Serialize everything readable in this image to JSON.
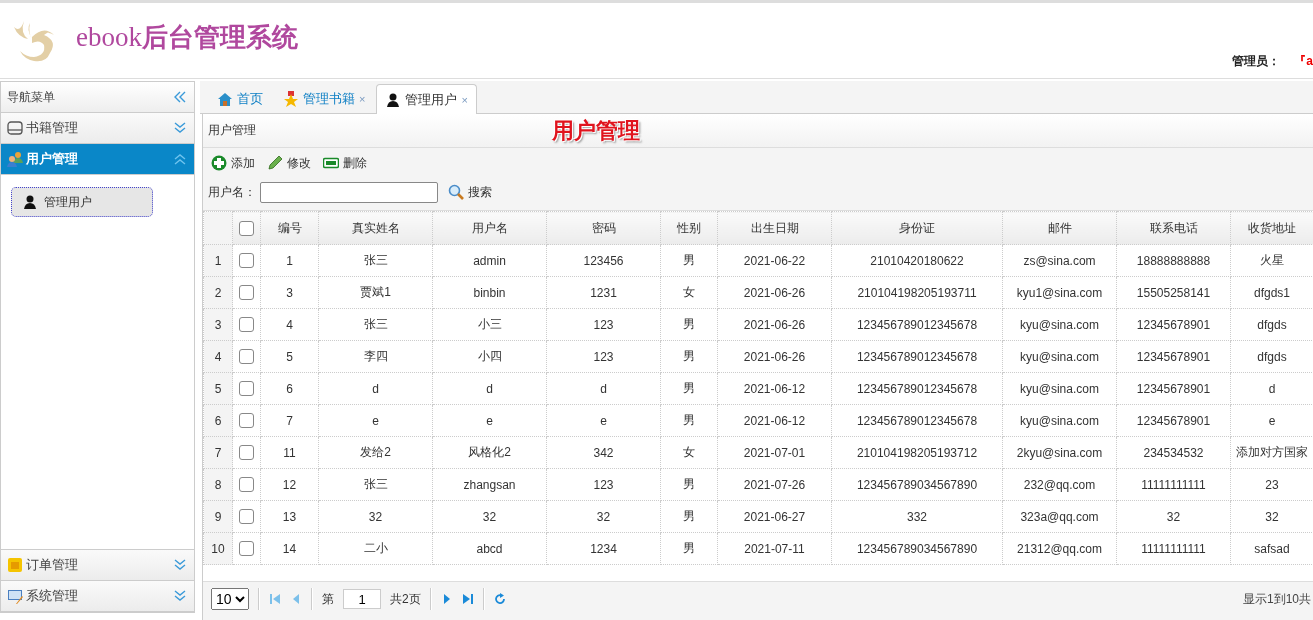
{
  "header": {
    "brand_prefix": "ebook",
    "brand_title": "后台管理系统",
    "admin_label": "管理员：",
    "admin_name": "『a"
  },
  "sidebar": {
    "title": "导航菜单",
    "sections": [
      {
        "label": "书籍管理",
        "kind": "drive",
        "selected": false,
        "expanded": false
      },
      {
        "label": "用户管理",
        "kind": "users",
        "selected": true,
        "expanded": true,
        "items": [
          {
            "label": "管理用户",
            "selected": true
          }
        ]
      },
      {
        "label": "订单管理",
        "kind": "folder",
        "selected": false,
        "expanded": false
      },
      {
        "label": "系统管理",
        "kind": "monitor",
        "selected": false,
        "expanded": false
      }
    ]
  },
  "tabs": [
    {
      "label": "首页",
      "kind": "home",
      "selected": false
    },
    {
      "label": "管理书籍",
      "kind": "star",
      "selected": false,
      "close": "×"
    },
    {
      "label": "管理用户",
      "kind": "user",
      "selected": true,
      "close": "×"
    }
  ],
  "panel": {
    "title": "用户管理",
    "banner": "用户管理",
    "toolbar": [
      {
        "label": "添加",
        "kind": "add"
      },
      {
        "label": "修改",
        "kind": "edit"
      },
      {
        "label": "删除",
        "kind": "delete"
      }
    ],
    "search": {
      "label": "用户名：",
      "button": "搜索"
    }
  },
  "table": {
    "header_checked": false,
    "columns": [
      "编号",
      "真实姓名",
      "用户名",
      "密码",
      "性别",
      "出生日期",
      "身份证",
      "邮件",
      "联系电话",
      "收货地址"
    ],
    "rows": [
      {
        "number": "1",
        "checked": false,
        "cells": [
          "1",
          "张三",
          "admin",
          "123456",
          "男",
          "2021-06-22",
          "21010420180622",
          "zs@sina.com",
          "18888888888",
          "火星"
        ]
      },
      {
        "number": "2",
        "checked": false,
        "cells": [
          "3",
          "贾斌1",
          "binbin",
          "1231",
          "女",
          "2021-06-26",
          "210104198205193711",
          "kyu1@sina.com",
          "15505258141",
          "dfgds1"
        ]
      },
      {
        "number": "3",
        "checked": false,
        "cells": [
          "4",
          "张三",
          "小三",
          "123",
          "男",
          "2021-06-26",
          "123456789012345678",
          "kyu@sina.com",
          "12345678901",
          "dfgds"
        ]
      },
      {
        "number": "4",
        "checked": false,
        "cells": [
          "5",
          "李四",
          "小四",
          "123",
          "男",
          "2021-06-26",
          "123456789012345678",
          "kyu@sina.com",
          "12345678901",
          "dfgds"
        ]
      },
      {
        "number": "5",
        "checked": false,
        "cells": [
          "6",
          "d",
          "d",
          "d",
          "男",
          "2021-06-12",
          "123456789012345678",
          "kyu@sina.com",
          "12345678901",
          "d"
        ]
      },
      {
        "number": "6",
        "checked": false,
        "cells": [
          "7",
          "e",
          "e",
          "e",
          "男",
          "2021-06-12",
          "123456789012345678",
          "kyu@sina.com",
          "12345678901",
          "e"
        ]
      },
      {
        "number": "7",
        "checked": false,
        "cells": [
          "11",
          "发给2",
          "风格化2",
          "342",
          "女",
          "2021-07-01",
          "210104198205193712",
          "2kyu@sina.com",
          "234534532",
          "添加对方国家"
        ]
      },
      {
        "number": "8",
        "checked": false,
        "cells": [
          "12",
          "张三",
          "zhangsan",
          "123",
          "男",
          "2021-07-26",
          "123456789034567890",
          "232@qq.com",
          "11111111111",
          "23"
        ]
      },
      {
        "number": "9",
        "checked": false,
        "cells": [
          "13",
          "32",
          "32",
          "32",
          "男",
          "2021-06-27",
          "332",
          "323a@qq.com",
          "32",
          "32"
        ]
      },
      {
        "number": "10",
        "checked": false,
        "cells": [
          "14",
          "二小",
          "abcd",
          "1234",
          "男",
          "2021-07-11",
          "123456789034567890",
          "21312@qq.com",
          "11111111111",
          "safsad"
        ]
      }
    ]
  },
  "pager": {
    "page_size": "10",
    "before": "第",
    "page": "1",
    "after": "共2页",
    "info": "显示1到10共"
  }
}
